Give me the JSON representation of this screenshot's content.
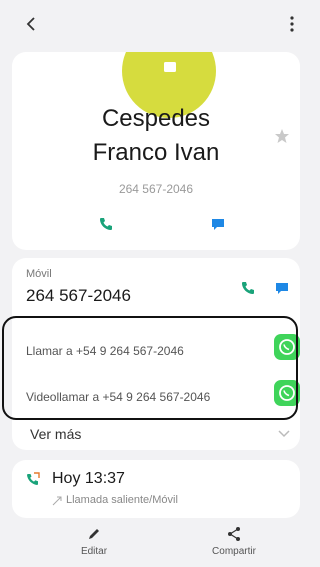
{
  "contact": {
    "name_line1": "Cespedes",
    "name_line2": "Franco Ivan",
    "number": "264 567-2046"
  },
  "numbers_card": {
    "label": "Móvil",
    "number": "264 567-2046",
    "call_label": "Llamar a +54 9 264 567-2046",
    "video_label": "Videollamar a +54 9 264 567-2046",
    "more_label": "Ver más"
  },
  "call_log": {
    "time": "Hoy 13:37",
    "detail": "Llamada saliente/Móvil"
  },
  "bottom_bar": {
    "edit_label": "Editar",
    "share_label": "Compartir"
  },
  "colors": {
    "accent_green": "#1aa37a",
    "accent_blue": "#1e88e5",
    "whatsapp_green": "#3fd45a",
    "avatar_yellow": "#d6dc3e"
  },
  "icons": [
    "back-icon",
    "more-icon",
    "star-icon",
    "phone-icon",
    "message-icon",
    "whatsapp-icon",
    "chevron-down-icon",
    "outgoing-call-icon",
    "edit-icon",
    "share-icon"
  ]
}
